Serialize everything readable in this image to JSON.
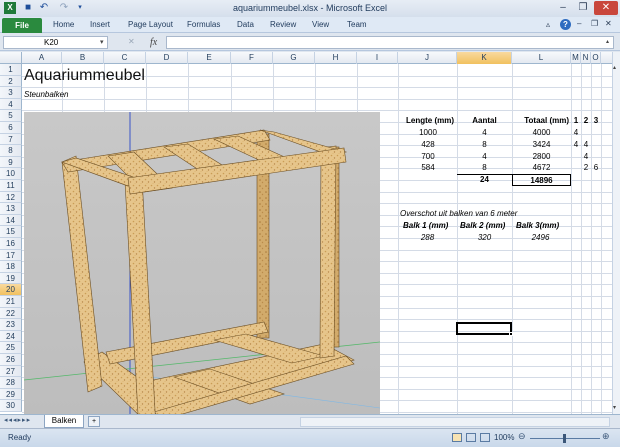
{
  "window": {
    "title": "aquariummeubel.xlsx - Microsoft Excel",
    "minimize": "–",
    "restore": "❐",
    "close": "✕"
  },
  "ribbon": {
    "file": "File",
    "tabs": [
      "Home",
      "Insert",
      "Page Layout",
      "Formulas",
      "Data",
      "Review",
      "View",
      "Team"
    ]
  },
  "formula_bar": {
    "name_box": "K20",
    "fx": "fx",
    "value": ""
  },
  "columns": [
    "A",
    "B",
    "C",
    "D",
    "E",
    "F",
    "G",
    "H",
    "I",
    "J",
    "K",
    "L",
    "M",
    "N",
    "O"
  ],
  "rows": [
    "1",
    "2",
    "3",
    "4",
    "5",
    "6",
    "7",
    "8",
    "9",
    "10",
    "11",
    "12",
    "13",
    "14",
    "15",
    "16",
    "17",
    "18",
    "19",
    "20",
    "21",
    "22",
    "23",
    "24",
    "25",
    "26",
    "27",
    "28",
    "29",
    "30"
  ],
  "selected": {
    "column": "K",
    "row": "20"
  },
  "sheet": {
    "title": "Aquariummeubel",
    "subtitle": "Steunbalken",
    "table_headers": {
      "lengte": "Lengte (mm)",
      "aantal": "Aantal",
      "totaal": "Totaal (mm)",
      "c1": "1",
      "c2": "2",
      "c3": "3"
    },
    "table_rows": [
      {
        "lengte": "1000",
        "aantal": "4",
        "totaal": "4000",
        "m": "4",
        "n": "",
        "o": ""
      },
      {
        "lengte": "428",
        "aantal": "8",
        "totaal": "3424",
        "m": "4",
        "n": "4",
        "o": ""
      },
      {
        "lengte": "700",
        "aantal": "4",
        "totaal": "2800",
        "m": "",
        "n": "4",
        "o": ""
      },
      {
        "lengte": "584",
        "aantal": "8",
        "totaal": "4672",
        "m": "",
        "n": "2",
        "o": "6"
      }
    ],
    "sum_aantal": "24",
    "sum_totaal": "14896",
    "overschot_label": "Overschot uit balken van 6 meter",
    "balk_headers": [
      "Balk 1 (mm)",
      "Balk 2 (mm)",
      "Balk 3(mm)"
    ],
    "balk_values": [
      "288",
      "320",
      "2496"
    ]
  },
  "sheet_tab": "Balken",
  "status": {
    "ready": "Ready",
    "zoom": "100%"
  }
}
